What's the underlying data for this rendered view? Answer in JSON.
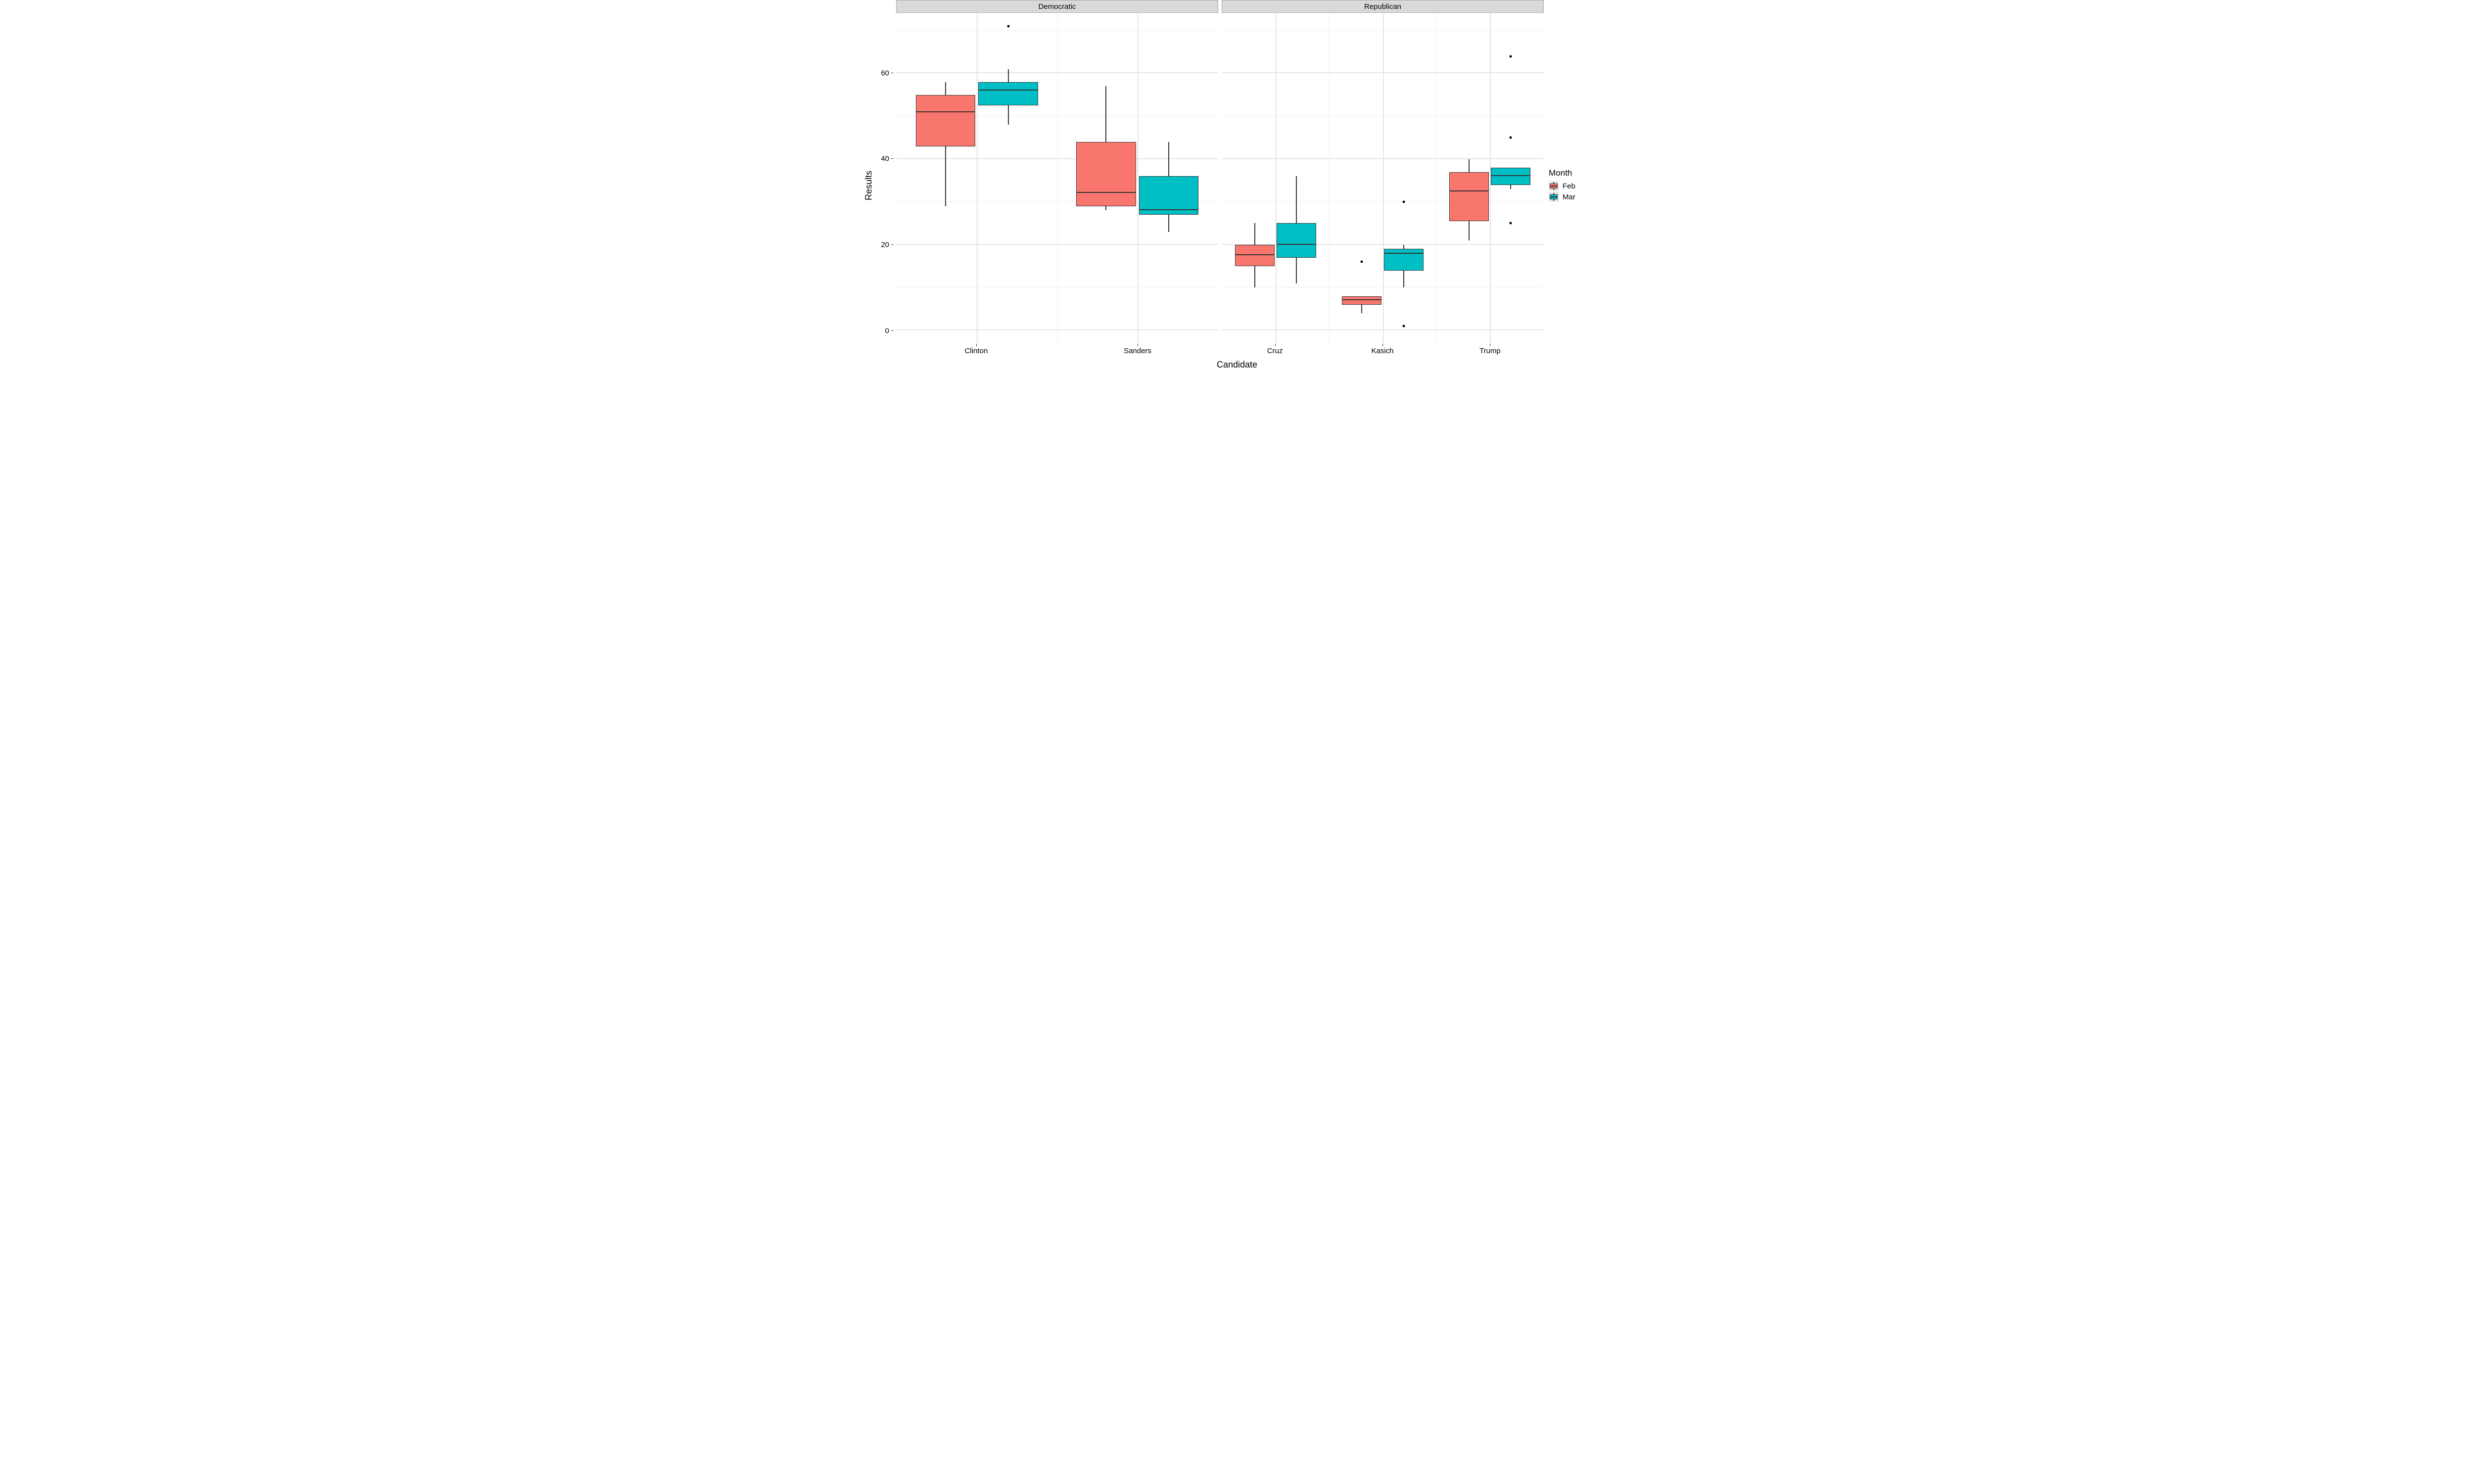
{
  "chart_data": {
    "type": "boxplot",
    "facets": [
      "Democratic",
      "Republican"
    ],
    "categories": {
      "Democratic": [
        "Clinton",
        "Sanders"
      ],
      "Republican": [
        "Cruz",
        "Kasich",
        "Trump"
      ]
    },
    "group_var": "Month",
    "groups": [
      "Feb",
      "Mar"
    ],
    "colors": {
      "Feb": "#f8766d",
      "Mar": "#00bfc4"
    },
    "ylabel": "Results",
    "xlabel": "Candidate",
    "ylim": [
      -3,
      74
    ],
    "y_ticks": [
      0,
      20,
      40,
      60
    ],
    "series": {
      "Democratic": {
        "Clinton": {
          "Feb": {
            "low": 29,
            "q1": 43,
            "median": 51,
            "q3": 55,
            "high": 58,
            "outliers": []
          },
          "Mar": {
            "low": 48,
            "q1": 52.5,
            "median": 56,
            "q3": 58,
            "high": 61,
            "outliers": [
              71
            ]
          }
        },
        "Sanders": {
          "Feb": {
            "low": 28,
            "q1": 29,
            "median": 32,
            "q3": 44,
            "high": 57,
            "outliers": []
          },
          "Mar": {
            "low": 23,
            "q1": 27,
            "median": 28,
            "q3": 36,
            "high": 44,
            "outliers": []
          }
        }
      },
      "Republican": {
        "Cruz": {
          "Feb": {
            "low": 10,
            "q1": 15,
            "median": 17.5,
            "q3": 20,
            "high": 25,
            "outliers": []
          },
          "Mar": {
            "low": 11,
            "q1": 17,
            "median": 20,
            "q3": 25,
            "high": 36,
            "outliers": []
          }
        },
        "Kasich": {
          "Feb": {
            "low": 4,
            "q1": 6,
            "median": 7,
            "q3": 8,
            "high": 8,
            "outliers": [
              16
            ]
          },
          "Mar": {
            "low": 10,
            "q1": 14,
            "median": 18,
            "q3": 19,
            "high": 20,
            "outliers": [
              1,
              30
            ]
          }
        },
        "Trump": {
          "Feb": {
            "low": 21,
            "q1": 25.5,
            "median": 32.5,
            "q3": 37,
            "high": 40,
            "outliers": []
          },
          "Mar": {
            "low": 33,
            "q1": 34,
            "median": 36,
            "q3": 38,
            "high": 38,
            "outliers": [
              25,
              45,
              64
            ]
          }
        }
      }
    }
  },
  "legend": {
    "title": "Month",
    "items": [
      {
        "label": "Feb",
        "class": "feb"
      },
      {
        "label": "Mar",
        "class": "mar"
      }
    ]
  }
}
